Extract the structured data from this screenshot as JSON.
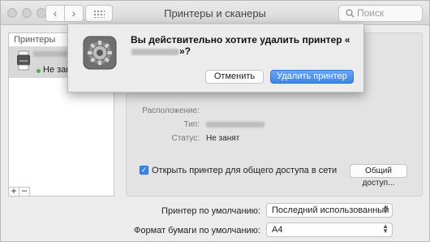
{
  "window": {
    "title": "Принтеры и сканеры",
    "search_placeholder": "Поиск"
  },
  "sidebar": {
    "header": "Принтеры",
    "items": [
      {
        "status": "Не занят"
      }
    ],
    "add_label": "+",
    "remove_label": "−"
  },
  "details": {
    "location_label": "Расположение:",
    "type_label": "Тип:",
    "status_label": "Статус:",
    "status_value": "Не занят",
    "share_checked": true,
    "share_label": "Открыть принтер для общего доступа в сети",
    "share_button": "Общий доступ..."
  },
  "defaults": {
    "printer_label": "Принтер по умолчанию:",
    "printer_value": "Последний использованный",
    "paper_label": "Формат бумаги по умолчанию:",
    "paper_value": "A4"
  },
  "dialog": {
    "message_prefix": "Вы действительно хотите удалить принтер «",
    "message_suffix": "»?",
    "cancel_label": "Отменить",
    "delete_label": "Удалить принтер"
  },
  "colors": {
    "accent": "#3d84e6",
    "status_green": "#4ab04a"
  }
}
